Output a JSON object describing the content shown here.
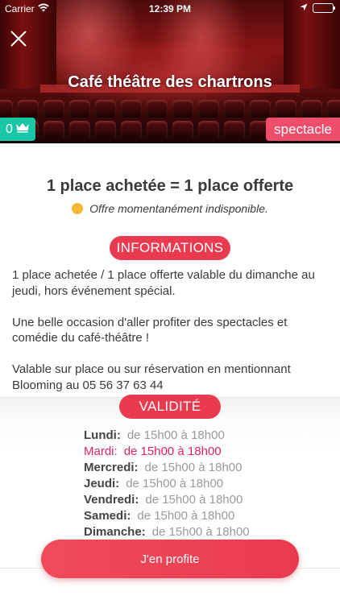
{
  "status_bar": {
    "carrier": "Carrier",
    "time": "12:39 PM"
  },
  "header": {
    "title": "Café théâtre des chartrons",
    "crown_count": "0",
    "category": "spectacle"
  },
  "offer": {
    "title": "1 place achetée = 1 place offerte",
    "availability": "Offre momentanément indisponible.",
    "availability_color": "#f5b731"
  },
  "informations": {
    "label": "INFORMATIONS",
    "paragraphs": [
      "1 place achetée / 1 place offerte valable du dimanche au jeudi, hors événement spécial.",
      "Une belle occasion d'aller profiter des spectacles et comédie du café-théâtre !",
      "Valable sur place ou sur réservation en mentionnant Blooming au 05 56 37 63 44"
    ]
  },
  "validity": {
    "label": "VALIDITÉ",
    "schedule": [
      {
        "day": "Lundi:",
        "hours": "de 15h00 à 18h00"
      },
      {
        "day": "Mardi:",
        "hours": "de 15h00 à 18h00"
      },
      {
        "day": "Mercredi:",
        "hours": "de 15h00 à 18h00"
      },
      {
        "day": "Jeudi:",
        "hours": "de 15h00 à 18h00"
      },
      {
        "day": "Vendredi:",
        "hours": "de 15h00 à 18h00"
      },
      {
        "day": "Samedi:",
        "hours": "de 15h00 à 18h00"
      },
      {
        "day": "Dimanche:",
        "hours": "de 15h00 à 18h00"
      }
    ]
  },
  "cta": {
    "label": "J'en profite"
  },
  "colors": {
    "accent": "#ea3a50",
    "teal": "#19c6a6",
    "highlight_day": "#e0245e"
  }
}
